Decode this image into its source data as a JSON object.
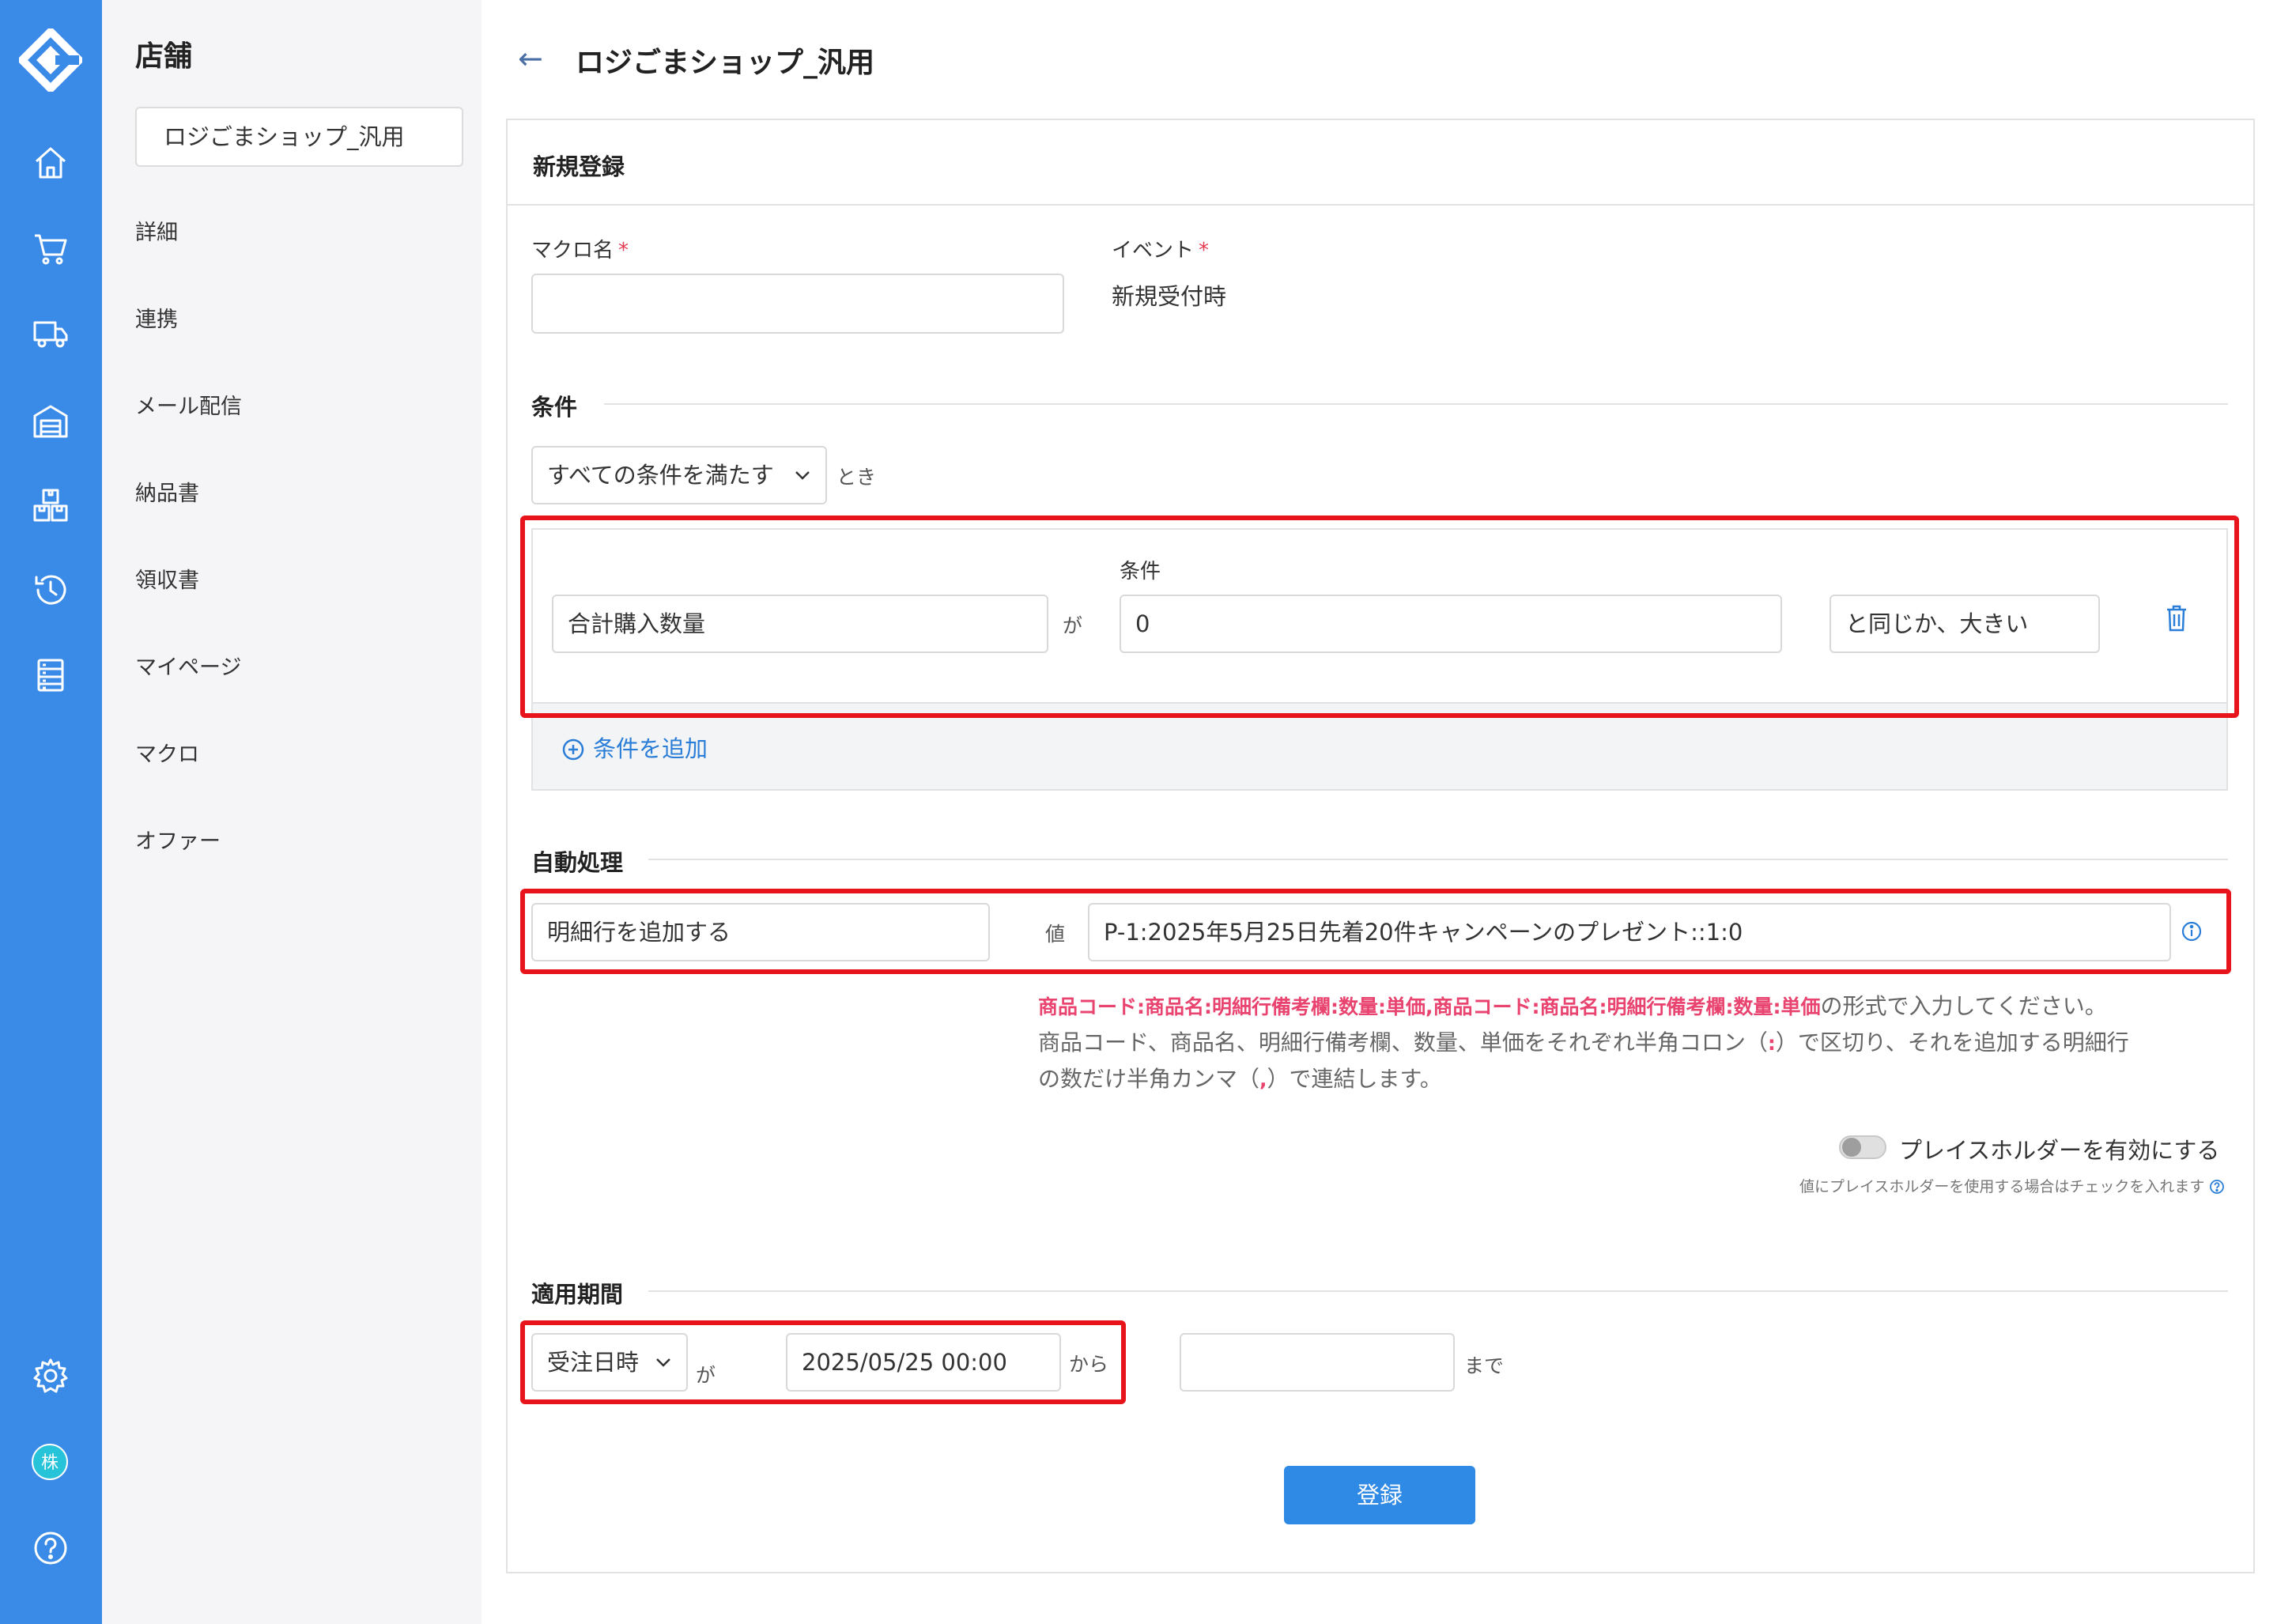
{
  "rail": {
    "icons": [
      "home-icon",
      "cart-icon",
      "truck-icon",
      "warehouse-icon",
      "boxes-icon",
      "history-icon",
      "list-icon",
      "gear-icon",
      "help-icon"
    ],
    "avatar_label": "株",
    "accent_color": "#3a8ae8"
  },
  "subnav": {
    "title": "店舗",
    "selector": "ロジごまショップ_汎用",
    "items": [
      "詳細",
      "連携",
      "メール配信",
      "納品書",
      "領収書",
      "マイページ",
      "マクロ",
      "オファー"
    ]
  },
  "header": {
    "back": "←",
    "title": "ロジごまショップ_汎用"
  },
  "card": {
    "title": "新規登録",
    "macro_name_label": "マクロ名",
    "required_mark": "*",
    "macro_name_value": "",
    "event_label": "イベント",
    "event_value": "新規受付時",
    "conditions": {
      "section_title": "条件",
      "match_select": "すべての条件を満たす",
      "match_suffix": "とき",
      "rows": [
        {
          "field": "合計購入数量",
          "particle": "が",
          "value_label": "条件",
          "value": "0",
          "operator": "と同じか、大きい"
        }
      ],
      "add_label": "条件を追加"
    },
    "auto": {
      "section_title": "自動処理",
      "action": "明細行を追加する",
      "value_label": "値",
      "value": "P-1:2025年5月25日先着20件キャンペーンのプレゼント::1:0",
      "help_pink": "商品コード:商品名:明細行備考欄:数量:単価,商品コード:商品名:明細行備考欄:数量:単価",
      "help_line1_rest": "の形式で入力してください。",
      "help_line2_a": "商品コード、商品名、明細行備考欄、数量、単価をそれぞれ半角コロン（",
      "help_colon": ":",
      "help_line2_b": "）で区切り、それを追加する明細行",
      "help_line3_a": "の数だけ半角カンマ（",
      "help_comma": ",",
      "help_line3_b": "）で連結します。",
      "placeholder_toggle_label": "プレイスホルダーを有効にする",
      "placeholder_toggle_on": false,
      "placeholder_note": "値にプレイスホルダーを使用する場合はチェックを入れます"
    },
    "period": {
      "section_title": "適用期間",
      "field": "受注日時",
      "particle": "が",
      "from_value": "2025/05/25 00:00",
      "from_suffix": "から",
      "to_value": "",
      "to_suffix": "まで"
    },
    "submit_label": "登録"
  }
}
